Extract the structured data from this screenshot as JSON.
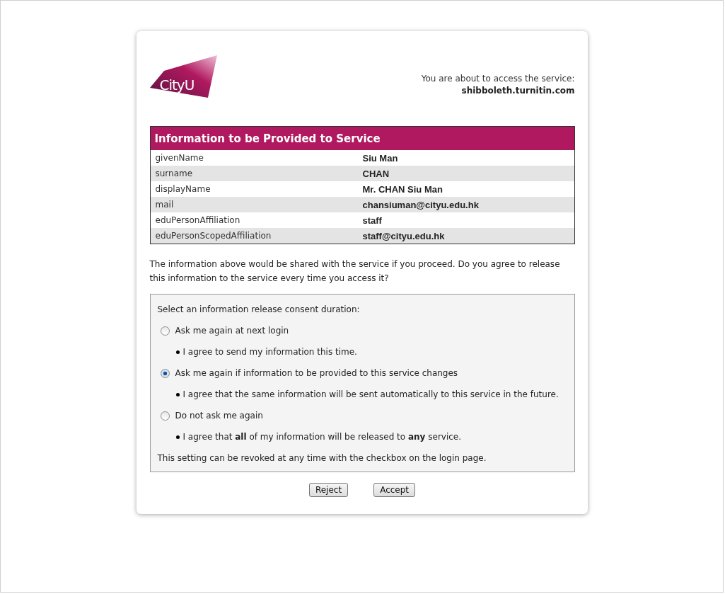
{
  "logo": {
    "text": "CityU"
  },
  "service": {
    "intro": "You are about to access the service:",
    "name": "shibboleth.turnitin.com"
  },
  "attributes": {
    "title": "Information to be Provided to Service",
    "rows": [
      {
        "name": "givenName",
        "value": "Siu Man"
      },
      {
        "name": "surname",
        "value": "CHAN"
      },
      {
        "name": "displayName",
        "value": "Mr. CHAN Siu Man"
      },
      {
        "name": "mail",
        "value": "chansiuman@cityu.edu.hk"
      },
      {
        "name": "eduPersonAffiliation",
        "value": "staff"
      },
      {
        "name": "eduPersonScopedAffiliation",
        "value": "staff@cityu.edu.hk"
      }
    ]
  },
  "question": "The information above would be shared with the service if you proceed. Do you agree to release this information to the service every time you access it?",
  "consent": {
    "heading": "Select an information release consent duration:",
    "options": [
      {
        "label": "Ask me again at next login",
        "detail": "I agree to send my information this time.",
        "selected": false
      },
      {
        "label": "Ask me again if information to be provided to this service changes",
        "detail": "I agree that the same information will be sent automatically to this service in the future.",
        "selected": true
      },
      {
        "label": "Do not ask me again",
        "detail": "I agree that **all** of my information will be released to **any** service.",
        "selected": false
      }
    ],
    "note": "This setting can be revoked at any time with the checkbox on the login page."
  },
  "buttons": [
    "Reject",
    "Accept"
  ]
}
